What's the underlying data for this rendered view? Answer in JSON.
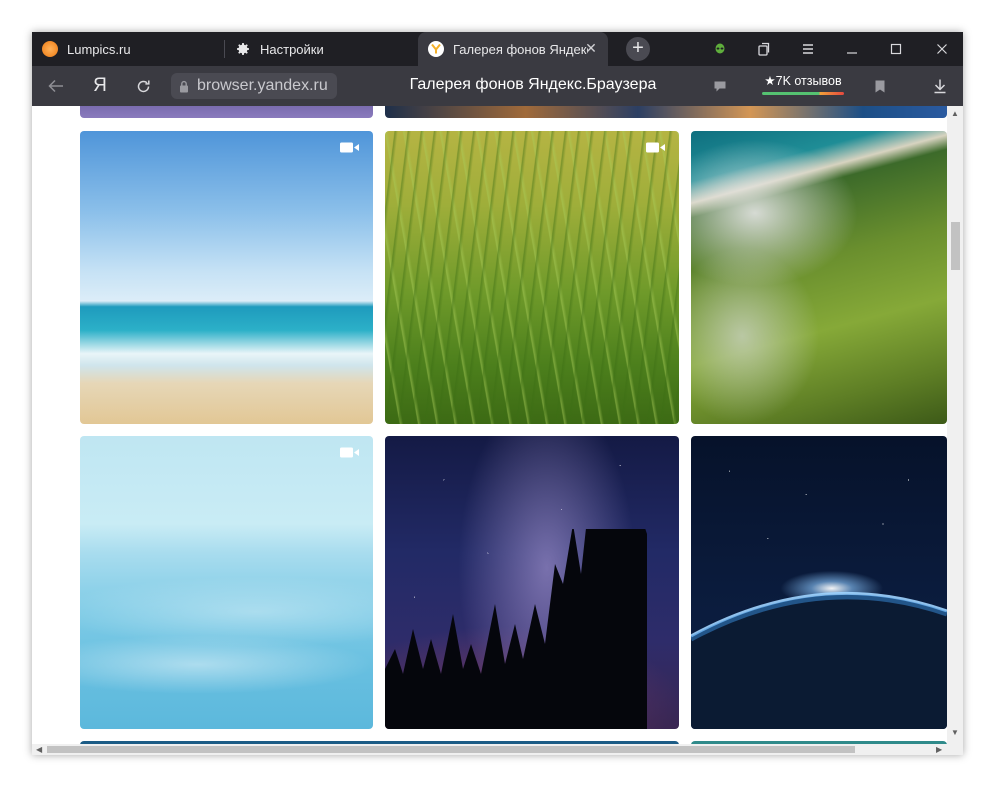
{
  "tabs": [
    {
      "title": "Lumpics.ru",
      "favicon": "lumpics-orange-icon"
    },
    {
      "title": "Настройки",
      "favicon": "gear-icon"
    },
    {
      "title": "Галерея фонов Яндекс.Браузера",
      "favicon": "yandex-y-icon",
      "active": true
    }
  ],
  "toolbar": {
    "new_tab_label": "+",
    "icons": [
      "extension-alien-icon",
      "collections-icon",
      "menu-icon",
      "minimize-icon",
      "maximize-icon",
      "close-icon"
    ]
  },
  "addressbar": {
    "back_icon": "back-arrow-icon",
    "yandex_button": "Я",
    "reload_icon": "reload-icon",
    "url": "browser.yandex.ru",
    "page_title": "Галерея фонов Яндекс.Браузера",
    "reviews_label": "★7K отзывов",
    "icons": [
      "feedback-icon",
      "bookmark-icon",
      "download-icon"
    ]
  },
  "gallery": {
    "items": [
      {
        "name": "beach-sea-sky",
        "video": true
      },
      {
        "name": "green-grass-dew",
        "video": true
      },
      {
        "name": "green-cliffs-coast",
        "video": false
      },
      {
        "name": "light-blue-sea",
        "video": true
      },
      {
        "name": "milky-way-forest",
        "video": false
      },
      {
        "name": "earth-from-space",
        "video": false
      }
    ]
  },
  "colors": {
    "tabstrip": "#1f1f24",
    "addressbar": "#3a3a41",
    "lumpics_favicon": "#f5902e",
    "alien_icon": "#5fae3c"
  }
}
